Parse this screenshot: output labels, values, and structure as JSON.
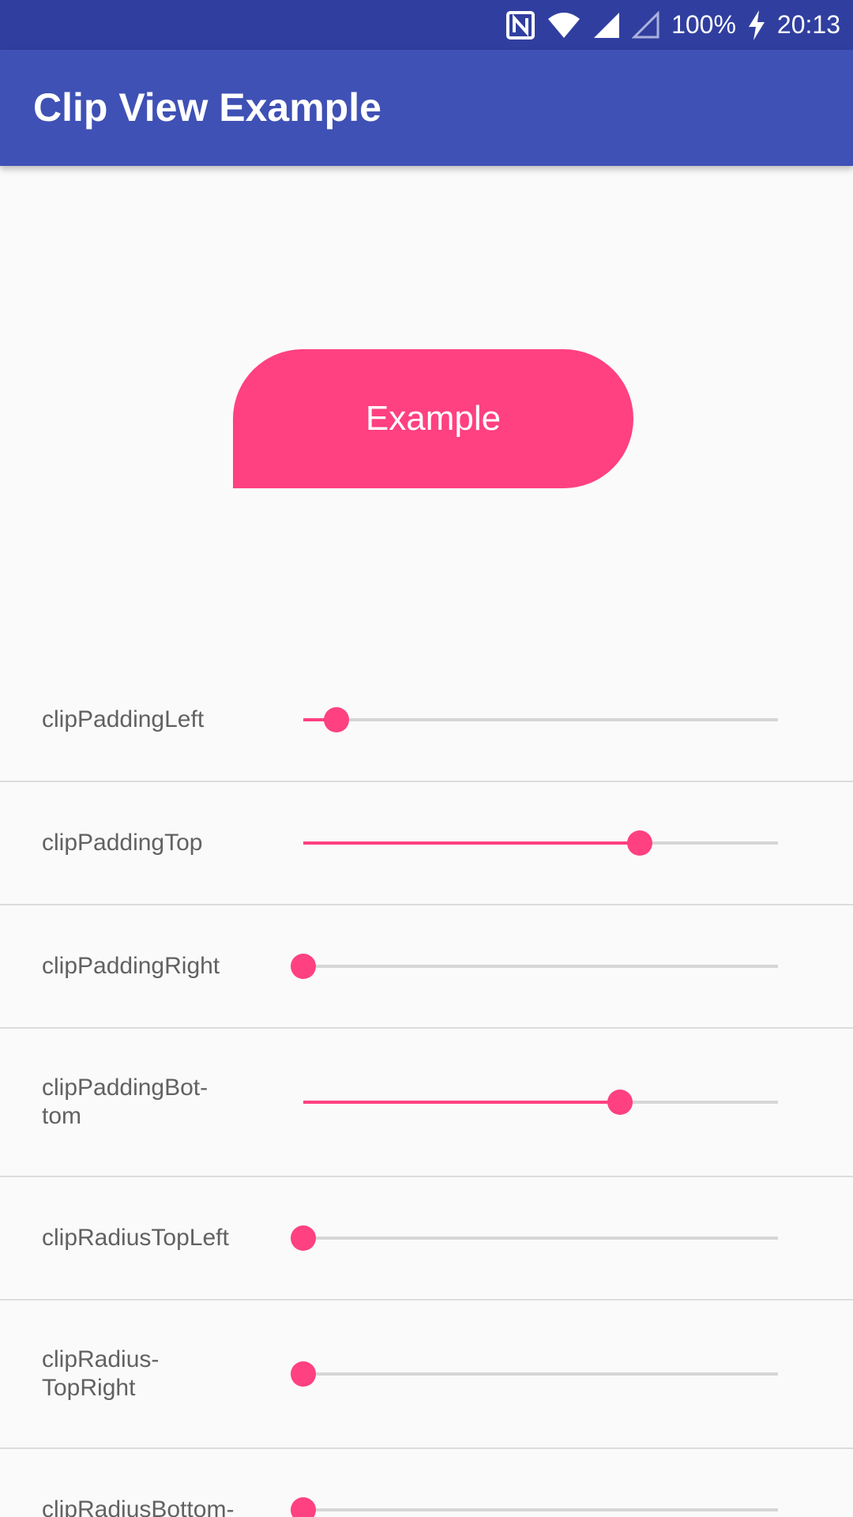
{
  "status_bar": {
    "nfc_icon": "nfc-icon",
    "wifi_icon": "wifi-icon",
    "signal_icon": "signal-icon",
    "signal2_icon": "signal-empty-icon",
    "battery": "100%",
    "charging_icon": "charging-bolt-icon",
    "time": "20:13"
  },
  "app_bar": {
    "title": "Clip View Example"
  },
  "preview": {
    "label": "Example"
  },
  "colors": {
    "accent": "#ff4081",
    "primary": "#3f51b5",
    "primary_dark": "#303f9f"
  },
  "controls": [
    {
      "label": "clipPaddingLeft",
      "progress": 0.07
    },
    {
      "label": "clipPaddingTop",
      "progress": 0.708
    },
    {
      "label": "clipPaddingRight",
      "progress": 0.0
    },
    {
      "label": "clipPaddingBot-\ntom",
      "progress": 0.668
    },
    {
      "label": "clipRadiusTopLeft",
      "progress": 0.0
    },
    {
      "label": "clipRadius-\nTopRight",
      "progress": 0.0
    },
    {
      "label": "clipRadiusBottom-",
      "progress": 0.0
    }
  ]
}
